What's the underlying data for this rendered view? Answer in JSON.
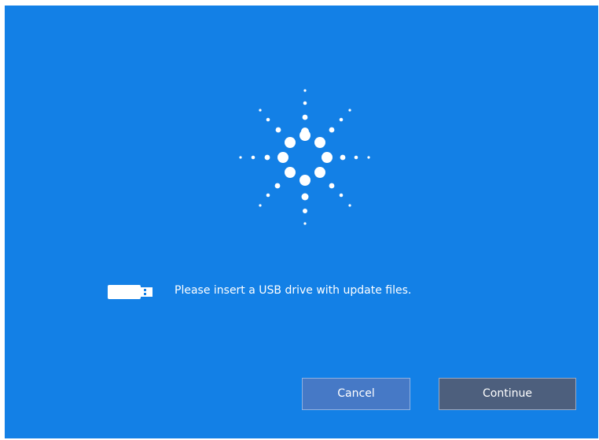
{
  "screen": {
    "background_color": "#1380e6",
    "logo_icon": "agilent-spark-logo-icon",
    "usb_icon": "usb-drive-icon",
    "message": "Please insert a USB drive with update files."
  },
  "buttons": {
    "cancel_label": "Cancel",
    "continue_label": "Continue"
  }
}
